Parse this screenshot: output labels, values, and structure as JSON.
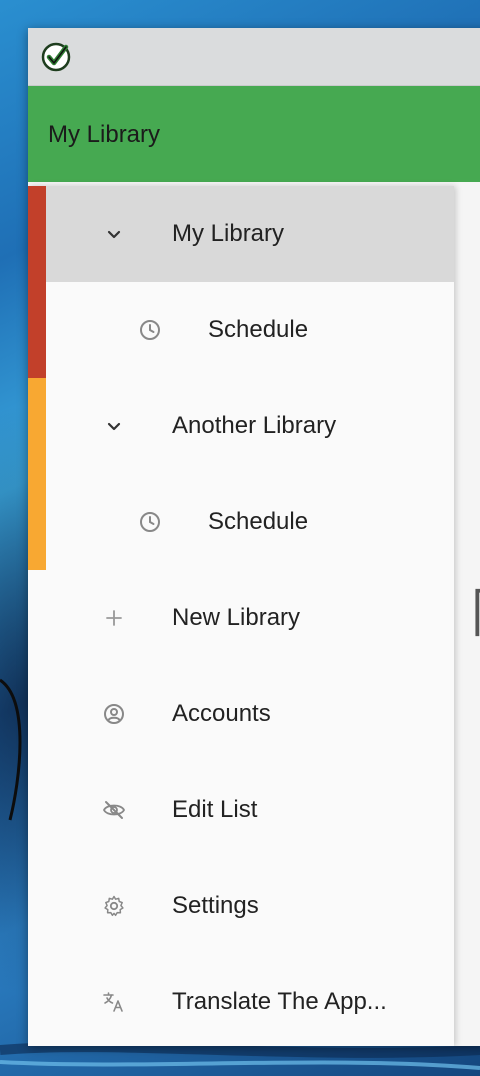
{
  "appbar": {
    "title": "My Library"
  },
  "drawer": {
    "items": [
      {
        "label": "My Library",
        "icon": "chevron-down-icon",
        "selected": true
      },
      {
        "label": "Schedule",
        "icon": "clock-icon"
      },
      {
        "label": "Another Library",
        "icon": "chevron-down-icon"
      },
      {
        "label": "Schedule",
        "icon": "clock-icon"
      },
      {
        "label": "New Library",
        "icon": "plus-icon"
      },
      {
        "label": "Accounts",
        "icon": "account-circle-icon"
      },
      {
        "label": "Edit List",
        "icon": "eye-off-icon"
      },
      {
        "label": "Settings",
        "icon": "gear-icon"
      },
      {
        "label": "Translate The App...",
        "icon": "translate-icon"
      }
    ],
    "library_colors": [
      "#c2402a",
      "#f8a832"
    ]
  },
  "colors": {
    "appbar": "#46a951",
    "selected": "#d9d9d9"
  }
}
